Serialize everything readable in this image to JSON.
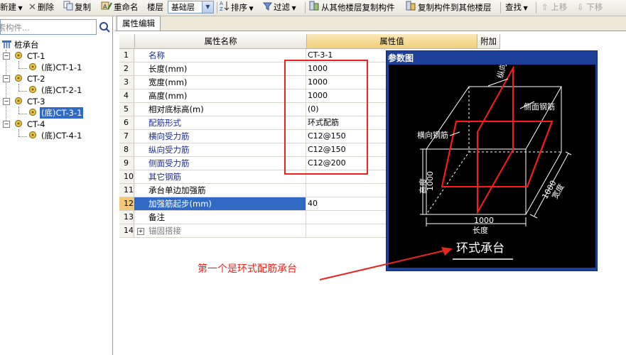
{
  "toolbar": {
    "new": "新建",
    "delete": "删除",
    "copy": "复制",
    "rename": "重命名",
    "floor_label": "楼层",
    "floor_value": "基础层",
    "sort": "排序",
    "filter": "过滤",
    "copy_from_other": "从其他楼层复制构件",
    "copy_to_other": "复制构件到其他楼层",
    "find": "查找",
    "move_up": "上移",
    "move_down": "下移"
  },
  "search": {
    "placeholder": "搜索构件..."
  },
  "tree": {
    "root": "桩承台",
    "items": [
      {
        "label": "CT-1",
        "child": "(底)CT-1-1"
      },
      {
        "label": "CT-2",
        "child": "(底)CT-2-1"
      },
      {
        "label": "CT-3",
        "child": "(底)CT-3-1"
      },
      {
        "label": "CT-4",
        "child": "(底)CT-4-1"
      }
    ]
  },
  "tab": {
    "label": "属性编辑"
  },
  "grid": {
    "headers": [
      "属性名称",
      "属性值",
      "附加"
    ],
    "rows": [
      {
        "no": "1",
        "name": "名称",
        "value": "CT-3-1"
      },
      {
        "no": "2",
        "name": "长度(mm)",
        "value": "1000"
      },
      {
        "no": "3",
        "name": "宽度(mm)",
        "value": "1000"
      },
      {
        "no": "4",
        "name": "高度(mm)",
        "value": "1000"
      },
      {
        "no": "5",
        "name": "相对底标高(m)",
        "value": "(0)"
      },
      {
        "no": "6",
        "name": "配筋形式",
        "value": "环式配筋"
      },
      {
        "no": "7",
        "name": "横向受力筋",
        "value": "C12@150"
      },
      {
        "no": "8",
        "name": "纵向受力筋",
        "value": "C12@150"
      },
      {
        "no": "9",
        "name": "侧面受力筋",
        "value": "C12@200"
      },
      {
        "no": "10",
        "name": "其它钢筋",
        "value": ""
      },
      {
        "no": "11",
        "name": "承台单边加强筋",
        "value": ""
      },
      {
        "no": "12",
        "name": "加强筋起步(mm)",
        "value": "40"
      },
      {
        "no": "13",
        "name": "备注",
        "value": ""
      },
      {
        "no": "14",
        "name": "锚固搭接",
        "value": ""
      }
    ]
  },
  "diagram": {
    "title": "参数图",
    "label_longitudinal": "纵向钢筋",
    "label_side": "侧面钢筋",
    "label_transverse": "横向钢筋",
    "label_height": "高度",
    "label_height_val": "1000",
    "label_length": "长度",
    "label_length_val": "1000",
    "label_width": "宽度",
    "label_width_val": "1000",
    "caption": "环式承台"
  },
  "annotation": {
    "text": "第一个是环式配筋承台"
  },
  "colors": {
    "accent_red": "#e8241c",
    "selection_blue": "#316ac5",
    "window_blue": "#1c3f9a"
  }
}
